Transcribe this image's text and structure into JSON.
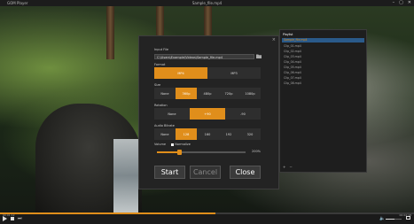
{
  "titlebar": {
    "app_name": "GOM Player",
    "window_title": "Sample_file.mp4",
    "minimize": "–",
    "maximize": "▢",
    "close": "✕"
  },
  "dialog": {
    "close": "×",
    "input_file_label": "Input File",
    "input_file_value": "C:\\Users\\Example\\Videos\\Sample_file.mp4",
    "format_label": "Format",
    "format_options": [
      "MP4",
      "MP3"
    ],
    "format_selected": "MP4",
    "size_label": "Size",
    "size_options": [
      "None",
      "360p",
      "480p",
      "720p",
      "1080p"
    ],
    "size_selected": "360p",
    "rotation_label": "Rotation",
    "rotation_options": [
      "None",
      "+90",
      "-90"
    ],
    "rotation_selected": "+90",
    "audio_bitrate_label": "Audio Bitrate",
    "audio_bitrate_options": [
      "None",
      "128",
      "160",
      "192",
      "320"
    ],
    "audio_bitrate_selected": "128",
    "volume_label": "Volume",
    "normalize_label": "Normalize",
    "volume_value": 0.25,
    "volume_text": "200%",
    "start_label": "Start",
    "cancel_label": "Cancel",
    "close_label": "Close"
  },
  "playlist": {
    "header": "Playlist",
    "active_item": "Sample_file.mp4",
    "items": [
      "Clip_01.mp4",
      "Clip_02.mp4",
      "Clip_03.mp4",
      "Clip_04.mp4",
      "Clip_05.mp4",
      "Clip_06.mp4",
      "Clip_07.mp4",
      "Clip_08.mp4"
    ],
    "add_icon": "+",
    "remove_icon": "−"
  },
  "controls": {
    "seek_fraction": 0.52,
    "volume_fraction": 0.55,
    "time_elapsed": "00:01:12",
    "time_total": "00:02:18"
  },
  "colors": {
    "accent": "#e08e1b"
  }
}
